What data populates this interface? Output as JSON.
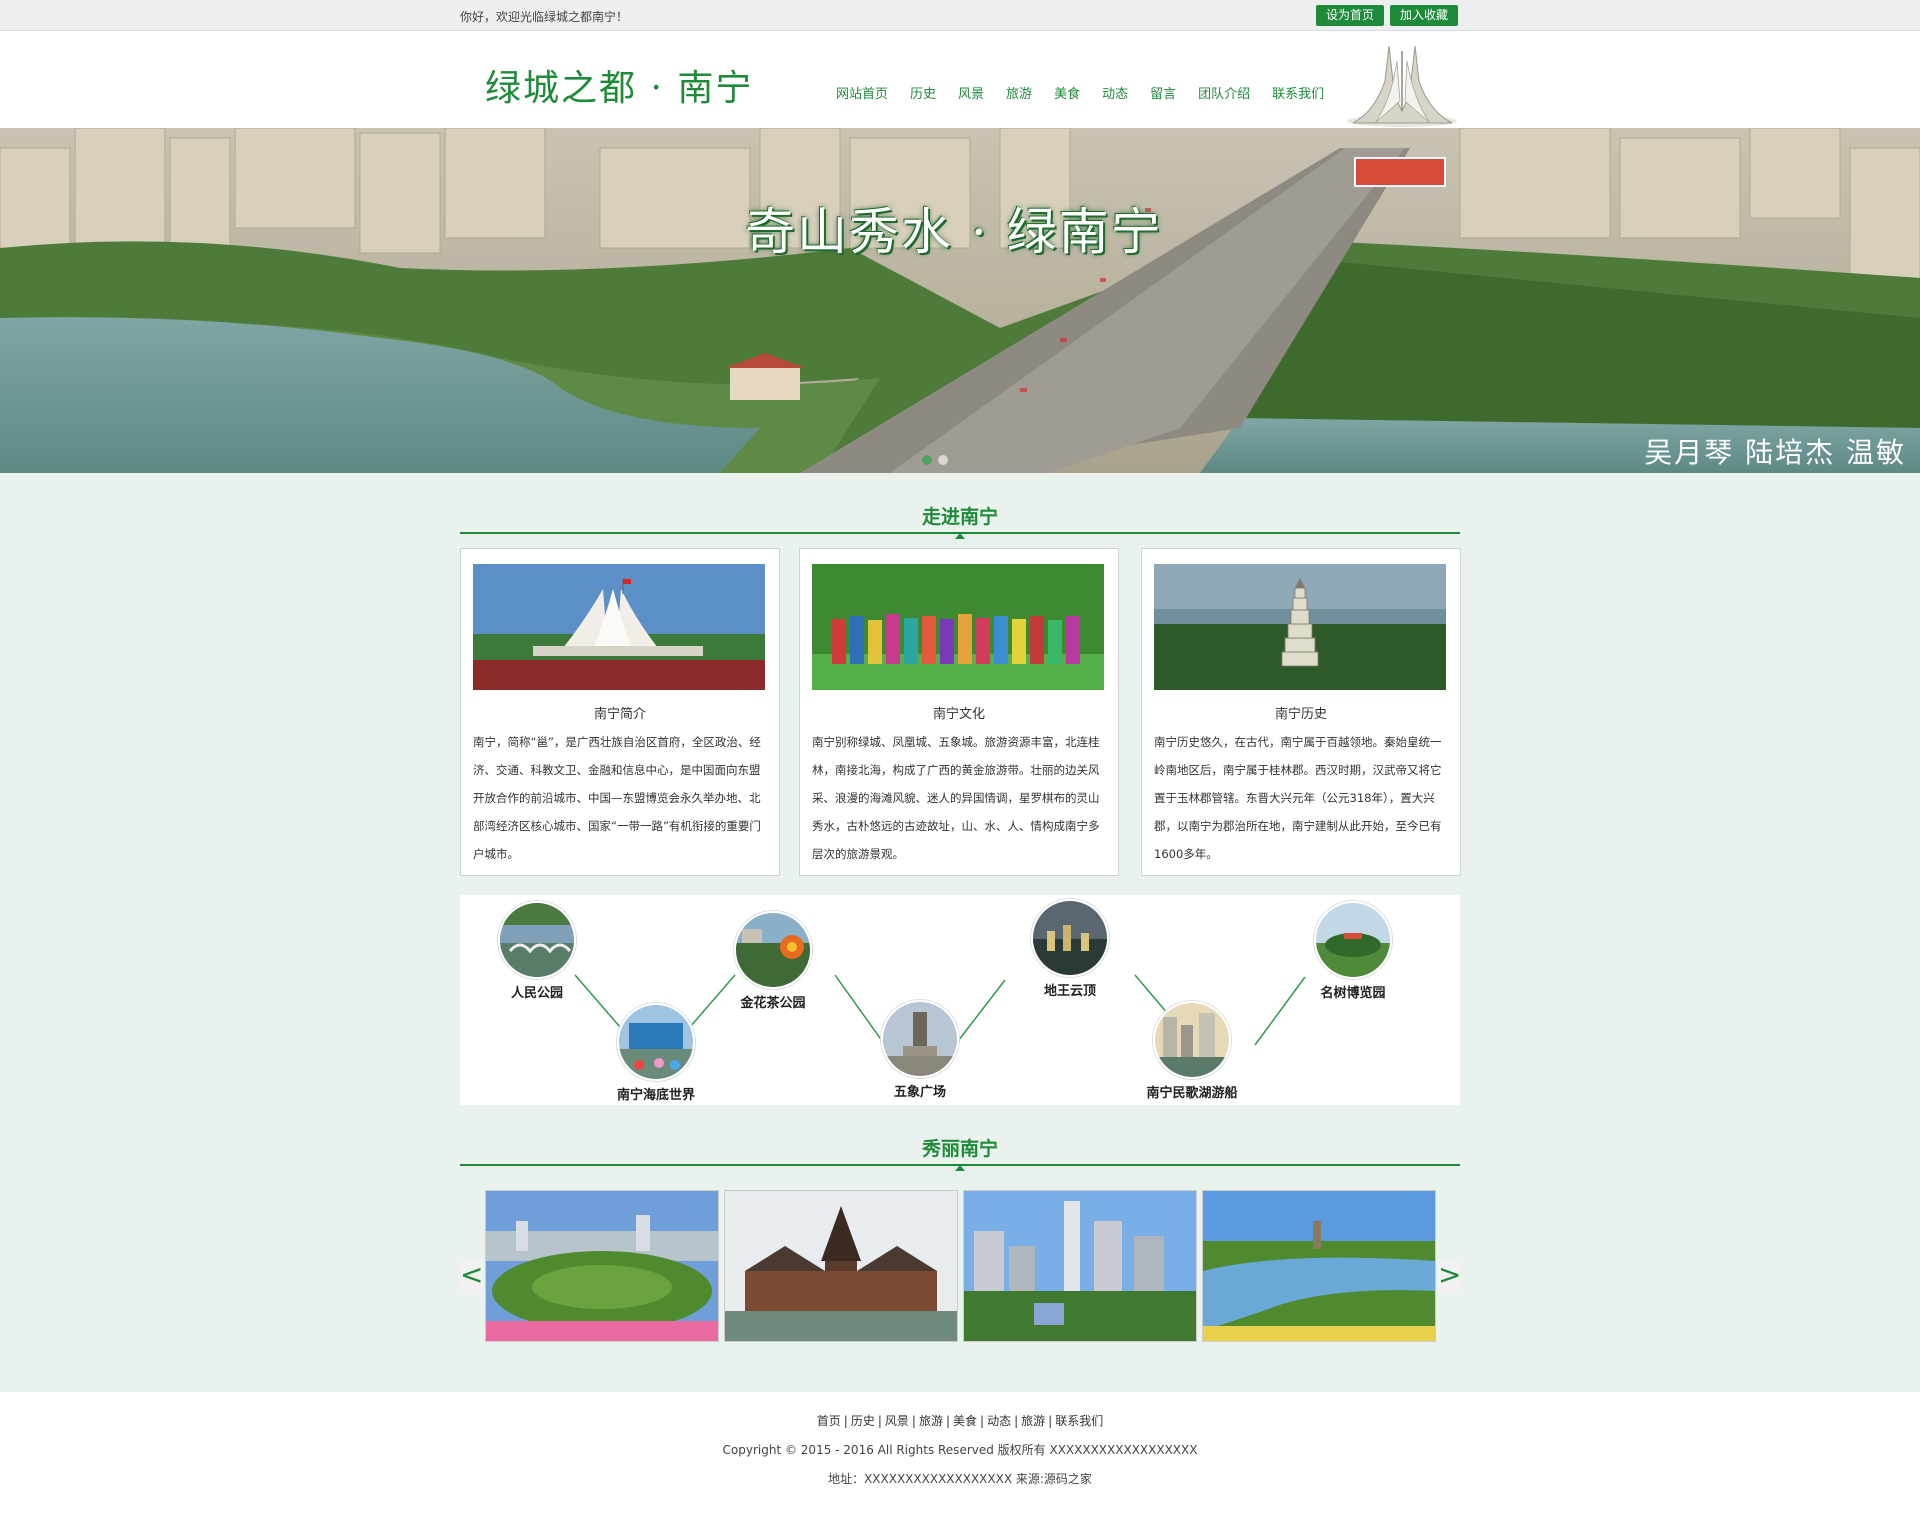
{
  "topbar": {
    "greeting": "你好，欢迎光临绿城之都南宁！",
    "set_home": "设为首页",
    "add_fav": "加入收藏"
  },
  "header": {
    "logo": "绿城之都 · 南宁",
    "nav": [
      "网站首页",
      "历史",
      "风景",
      "旅游",
      "美食",
      "动态",
      "留言",
      "团队介绍",
      "联系我们"
    ]
  },
  "banner": {
    "title": "奇山秀水 · 绿南宁",
    "credit": "吴月琴 陆培杰 温敏",
    "slide_count": 2,
    "active_slide": 1
  },
  "section1": {
    "title": "走进南宁"
  },
  "cards": [
    {
      "title": "南宁简介",
      "text": "南宁，简称“邕”，是广西壮族自治区首府，全区政治、经济、交通、科教文卫、金融和信息中心，是中国面向东盟开放合作的前沿城市、中国—东盟博览会永久举办地、北部湾经济区核心城市、国家“一带一路”有机衔接的重要门户城市。"
    },
    {
      "title": "南宁文化",
      "text": "南宁别称绿城、凤凰城、五象城。旅游资源丰富，北连桂林，南接北海，构成了广西的黄金旅游带。壮丽的边关风采、浪漫的海滩风貌、迷人的异国情调，星罗棋布的灵山秀水，古朴悠远的古迹故址，山、水、人、情构成南宁多层次的旅游景观。"
    },
    {
      "title": "南宁历史",
      "text": "南宁历史悠久，在古代，南宁属于百越领地。秦始皇统一岭南地区后，南宁属于桂林郡。西汉时期，汉武帝又将它置于玉林郡管辖。东晋大兴元年（公元318年），置大兴郡，以南宁为郡治所在地，南宁建制从此开始，至今已有1600多年。"
    }
  ],
  "spots": [
    {
      "name": "人民公园",
      "icon": "park-bridge"
    },
    {
      "name": "南宁海底世界",
      "icon": "aquarium"
    },
    {
      "name": "金花茶公园",
      "icon": "flower-park"
    },
    {
      "name": "五象广场",
      "icon": "statue-square"
    },
    {
      "name": "地王云顶",
      "icon": "skyline"
    },
    {
      "name": "南宁民歌湖游船",
      "icon": "lake-boat"
    },
    {
      "name": "名树博览园",
      "icon": "tree-garden"
    }
  ],
  "section2": {
    "title": "秀丽南宁"
  },
  "gallery": {
    "prev": "<",
    "next": ">",
    "images": [
      "convention-center",
      "drum-tower",
      "city-skyline",
      "river-park"
    ]
  },
  "footer": {
    "links": [
      "首页",
      "历史",
      "风景",
      "旅游",
      "美食",
      "动态",
      "旅游",
      "联系我们"
    ],
    "copyright": "Copyright © 2015 - 2016 All Rights Reserved 版权所有 XXXXXXXXXXXXXXXXXX",
    "address": "地址：XXXXXXXXXXXXXXXXXX 来源:源码之家"
  },
  "colors": {
    "brand": "#1e8b3a",
    "bg": "#e9f2ec"
  }
}
